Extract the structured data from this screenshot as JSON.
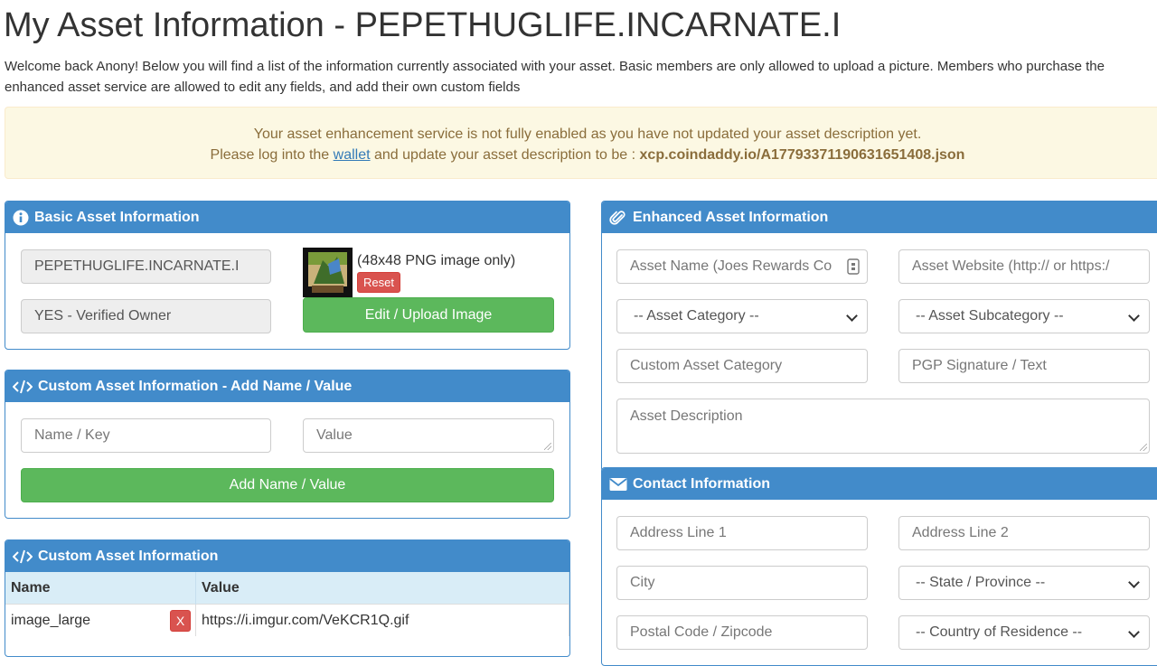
{
  "page": {
    "title": "My Asset Information - PEPETHUGLIFE.INCARNATE.I",
    "intro_line1": "Welcome back Anony! Below you will find a list of the information currently associated with your asset. Basic members are only allowed to upload a picture. Members who purchase the",
    "intro_line2": "enhanced asset service are allowed to edit any fields, and add their own custom fields"
  },
  "alert": {
    "line1": "Your asset enhancement service is not fully enabled as you have not updated your asset description yet.",
    "line2_pre": "Please log into the",
    "link": "wallet",
    "line2_mid": "and update your asset description to be :",
    "value": "xcp.coindaddy.io/A17793371190631651408.json"
  },
  "basic": {
    "heading": "Basic Asset Information",
    "asset_name": "PEPETHUGLIFE.INCARNATE.I",
    "owner_status": "YES - Verified Owner",
    "image_note": "(48x48 PNG image only)",
    "reset_label": "Reset",
    "upload_label": "Edit / Upload Image"
  },
  "custom_add": {
    "heading": "Custom Asset Information - Add Name / Value",
    "name_placeholder": "Name / Key",
    "value_placeholder": "Value",
    "add_label": "Add Name / Value"
  },
  "custom_list": {
    "heading": "Custom Asset Information",
    "columns": [
      "Name",
      "Value"
    ],
    "rows": [
      {
        "name": "image_large",
        "delete_label": "X",
        "value": "https://i.imgur.com/VeKCR1Q.gif"
      }
    ]
  },
  "enhanced": {
    "heading": "Enhanced Asset Information",
    "asset_name_placeholder": "Asset Name (Joes Rewards Co",
    "website_placeholder": "Asset Website (http:// or https:/",
    "category_select": "-- Asset Category --",
    "subcategory_select": "-- Asset Subcategory --",
    "custom_category_placeholder": "Custom Asset Category",
    "pgp_placeholder": "PGP Signature / Text",
    "description_placeholder": "Asset Description"
  },
  "contact": {
    "heading": "Contact Information",
    "address1_placeholder": "Address Line 1",
    "address2_placeholder": "Address Line 2",
    "city_placeholder": "City",
    "state_select": "-- State / Province --",
    "postal_placeholder": "Postal Code / Zipcode",
    "country_select": "-- Country of Residence --"
  },
  "colors": {
    "primary": "#428bca",
    "success": "#5cb85c",
    "danger": "#d9534f",
    "warning_bg": "#fcf8e3",
    "warning_text": "#8a6d3b"
  }
}
